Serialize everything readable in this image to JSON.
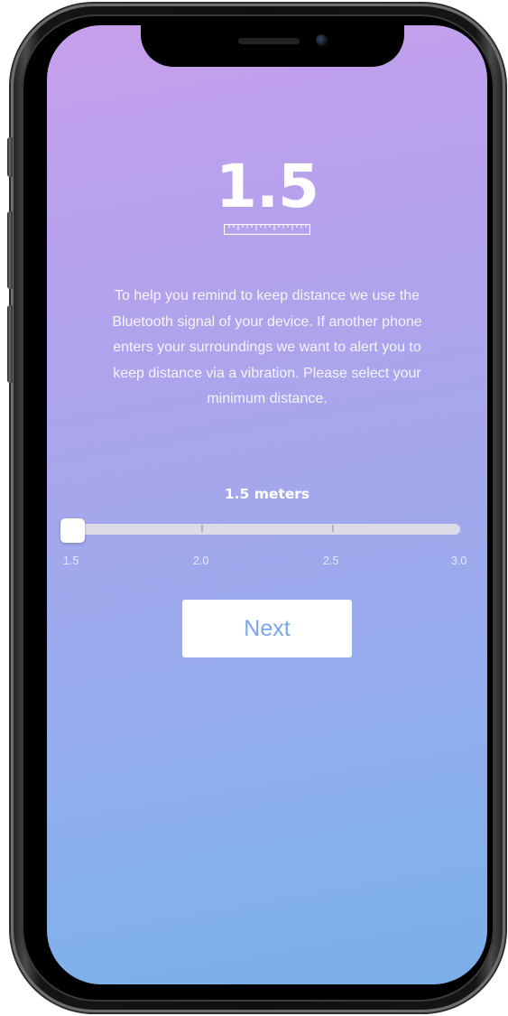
{
  "header": {
    "distance_value": "1.5"
  },
  "description": {
    "text": "To help you remind to keep distance we use the Bluetooth signal of your device. If another phone enters your surroundings we want to alert you to keep distance via a vibration. Please select your minimum distance."
  },
  "slider": {
    "value_label": "1.5 meters",
    "value": 1.5,
    "min": 1.5,
    "max": 3.0,
    "scale_labels": [
      "1.5",
      "2.0",
      "2.5",
      "3.0"
    ]
  },
  "actions": {
    "next_label": "Next"
  },
  "colors": {
    "gradient_top": "#c7a0ec",
    "gradient_bottom": "#7aafe9",
    "button_text": "#7aa7e8"
  },
  "icons": {
    "ruler": "ruler-icon"
  }
}
